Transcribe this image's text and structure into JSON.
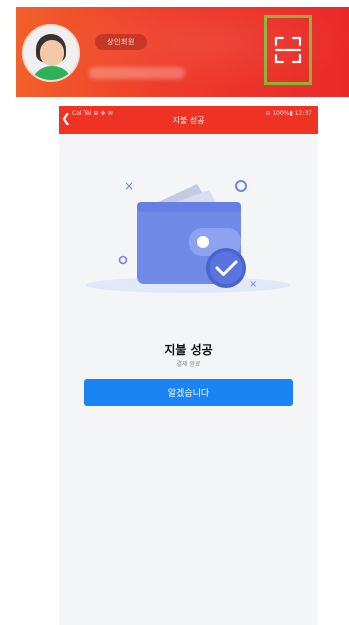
{
  "banner": {
    "member_badge": "상인회원",
    "scan_icon": "qr-scan-icon",
    "colors": {
      "gradient_start": "#f2602a",
      "gradient_end": "#e92a29",
      "highlight": "#8cb23a"
    }
  },
  "phone": {
    "status_bar": {
      "title": "지불 성공",
      "left_text": "Cal Tel ⊕ ❖ ✉",
      "right_text": "⊙ 100%▮ 12:37",
      "back_icon": "back-arrow-icon",
      "color": "#ee3224"
    },
    "illustration_icon": "wallet-success-icon",
    "result": {
      "title": "지불 성공",
      "subtitle": "결제 완료"
    },
    "confirm_button": {
      "label": "알겠습니다",
      "color": "#1a84f4"
    }
  }
}
